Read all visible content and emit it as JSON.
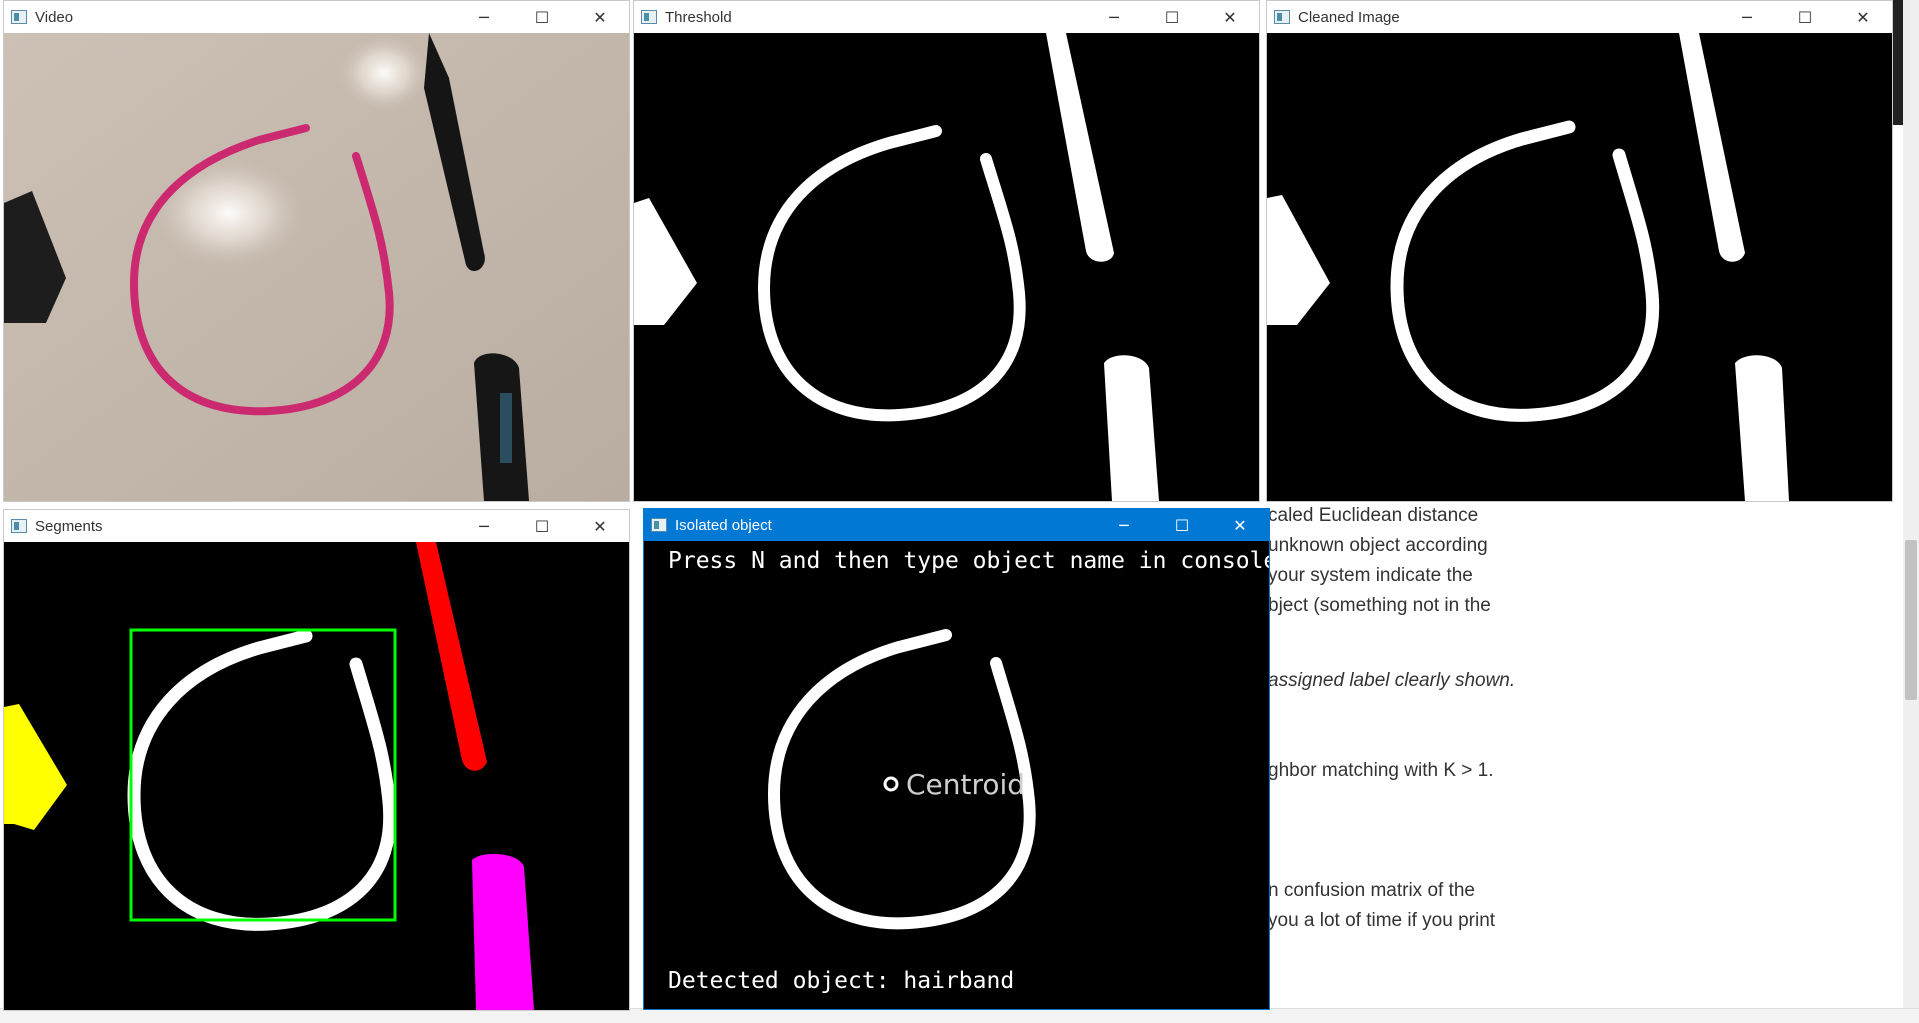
{
  "background_doc": {
    "lines": [
      {
        "text": "caled Euclidean distance",
        "italic": false
      },
      {
        "text": "unknown object according",
        "italic": false
      },
      {
        "text": "your system indicate the",
        "italic": false
      },
      {
        "text": "bject (something not in the",
        "italic": false
      },
      {
        "text": "assigned label clearly shown.",
        "italic": true
      },
      {
        "text": "ghbor matching with K > 1.",
        "italic": false
      },
      {
        "text": "n confusion matrix of the",
        "italic": false
      },
      {
        "text": "you a lot of time if you print",
        "italic": false
      }
    ]
  },
  "windows": {
    "video": {
      "title": "Video"
    },
    "threshold": {
      "title": "Threshold"
    },
    "cleaned": {
      "title": "Cleaned Image"
    },
    "segments": {
      "title": "Segments"
    },
    "isolated": {
      "title": "Isolated object",
      "prompt": "Press N and then type object name in console",
      "centroid_label": "Centroid",
      "detected": "Detected object: hairband"
    }
  },
  "controls": {
    "minimize": "─",
    "maximize": "☐",
    "close": "✕"
  },
  "colors": {
    "active_titlebar": "#0078d4",
    "bbox": "#00ff00",
    "segment_red": "#ff0000",
    "segment_yellow": "#ffff00",
    "segment_magenta": "#ff00ff",
    "hairband": "#cc2a70"
  }
}
